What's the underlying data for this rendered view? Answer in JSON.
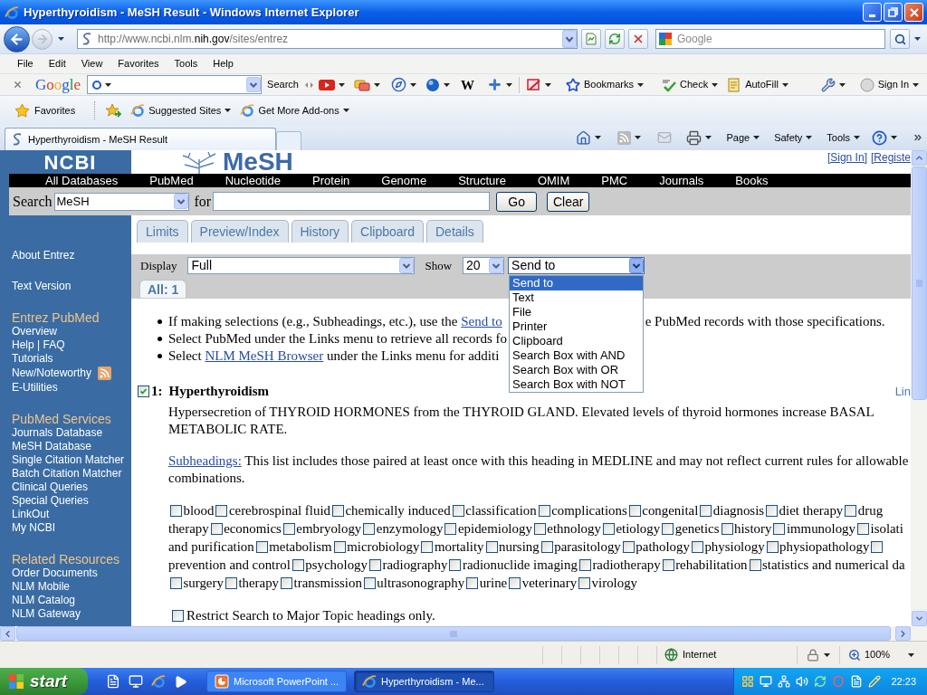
{
  "window": {
    "title": "Hyperthyroidism - MeSH Result - Windows Internet Explorer"
  },
  "address_bar": {
    "forward_button": {
      "disabled": true
    },
    "url_prefix": "http://www.ncbi.nlm.",
    "url_domain": "nih.gov",
    "url_path": "/sites/entrez",
    "search_placeholder": "Google"
  },
  "menu_bar": [
    "File",
    "Edit",
    "View",
    "Favorites",
    "Tools",
    "Help"
  ],
  "google_toolbar": {
    "logo": "Google",
    "search_button": "Search",
    "wiki_button": "W",
    "buttons": [
      "Bookmarks",
      "Check",
      "AutoFill",
      "Sign In"
    ]
  },
  "favorites_bar": {
    "favorites": "Favorites",
    "links": [
      "Suggested Sites",
      "Get More Add-ons"
    ]
  },
  "tabs": [
    {
      "label": "Hyperthyroidism - MeSH Result",
      "selected": true
    }
  ],
  "command_bar": {
    "read_mail": {
      "disabled": true
    },
    "menus": [
      "Page",
      "Safety",
      "Tools"
    ]
  },
  "page": {
    "header": {
      "ncbi_logo": "NCBI",
      "mesh_logo": "MeSH",
      "links": [
        "[Sign In]",
        "[Registe"
      ]
    },
    "databases": [
      "All Databases",
      "PubMed",
      "Nucleotide",
      "Protein",
      "Genome",
      "Structure",
      "OMIM",
      "PMC",
      "Journals",
      "Books"
    ],
    "search": {
      "label": "Search",
      "database": "MeSH",
      "for_label": "for",
      "buttons": [
        "Go",
        "Clear"
      ]
    },
    "sidebar": [
      {
        "items": [
          {
            "label": "About Entrez"
          }
        ]
      },
      {
        "items": [
          {
            "label": "Text Version"
          }
        ]
      },
      {
        "heading": "Entrez PubMed",
        "items": [
          {
            "label": "Overview"
          },
          {
            "label": "Help | FAQ"
          },
          {
            "label": "Tutorials"
          },
          {
            "label": "New/Noteworthy",
            "rss": true
          },
          {
            "label": "E-Utilities"
          }
        ]
      },
      {
        "heading": "PubMed Services",
        "items": [
          {
            "label": "Journals Database"
          },
          {
            "label": "MeSH Database"
          },
          {
            "label": "Single Citation Matcher"
          },
          {
            "label": "Batch Citation Matcher"
          },
          {
            "label": "Clinical Queries"
          },
          {
            "label": "Special Queries"
          },
          {
            "label": "LinkOut"
          },
          {
            "label": "My NCBI"
          }
        ]
      },
      {
        "heading": "Related Resources",
        "items": [
          {
            "label": "Order Documents"
          },
          {
            "label": "NLM Mobile"
          },
          {
            "label": "NLM Catalog"
          },
          {
            "label": "NLM Gateway"
          }
        ]
      }
    ],
    "tabs": [
      {
        "label": "Limits",
        "selected": false
      },
      {
        "label": "Preview/Index",
        "selected": false
      },
      {
        "label": "History",
        "selected": false
      },
      {
        "label": "Clipboard",
        "selected": false
      },
      {
        "label": "Details",
        "selected": false
      }
    ],
    "display": {
      "label": "Display",
      "value": "Full",
      "show_label": "Show",
      "show_value": "20",
      "send_to": {
        "value": "Send to",
        "expanded": true,
        "options": [
          {
            "label": "Send to",
            "selected": true
          },
          {
            "label": "Text",
            "selected": false
          },
          {
            "label": "File",
            "selected": false
          },
          {
            "label": "Printer",
            "selected": false
          },
          {
            "label": "Clipboard",
            "selected": false
          },
          {
            "label": "Search Box with AND",
            "selected": false
          },
          {
            "label": "Search Box with OR",
            "selected": false
          },
          {
            "label": "Search Box with NOT",
            "selected": false
          }
        ]
      }
    },
    "result_tabs": [
      {
        "label": "All: 1",
        "selected": true
      }
    ],
    "tips": [
      {
        "segments": [
          {
            "kind": "text",
            "text": "If making selections (e.g., Subheadings, etc.), use the "
          },
          {
            "kind": "link",
            "text": "Send to"
          },
          {
            "kind": "covered"
          },
          {
            "kind": "text",
            "text": "e PubMed records with those specifications."
          }
        ]
      },
      {
        "segments": [
          {
            "kind": "text",
            "text": "Select PubMed under the Links menu to retrieve all records fo"
          }
        ]
      },
      {
        "segments": [
          {
            "kind": "text",
            "text": "Select "
          },
          {
            "kind": "link",
            "text": "NLM MeSH Browser"
          },
          {
            "kind": "text",
            "text": " under the Links menu for additi"
          }
        ]
      }
    ],
    "record": {
      "checked": true,
      "number": "1:",
      "title": "Hyperthyroidism",
      "links": "Lin",
      "description": "Hypersecretion of THYROID HORMONES from the THYROID GLAND. Elevated levels of thyroid hormones increase BASAL METABOLIC RATE.",
      "subheadings_link": "Subheadings:",
      "subheadings_note": "This list includes those paired at least once with this heading in MEDLINE and may not reflect current rules for allowable combinations.",
      "subheading_lines": [
        [
          {
            "kind": "option",
            "label": "blood",
            "checked": false
          },
          {
            "kind": "option",
            "label": "cerebrospinal fluid",
            "checked": false
          },
          {
            "kind": "option",
            "label": "chemically induced",
            "checked": false
          },
          {
            "kind": "option",
            "label": "classification",
            "checked": false
          },
          {
            "kind": "option",
            "label": "complications",
            "checked": false
          },
          {
            "kind": "option",
            "label": "congenital",
            "checked": false
          },
          {
            "kind": "option",
            "label": "diagnosis",
            "checked": false
          },
          {
            "kind": "option",
            "label": "diet therapy",
            "checked": false
          },
          {
            "kind": "option",
            "label": "drug",
            "checked": false
          }
        ],
        [
          {
            "kind": "text",
            "label": "therapy"
          },
          {
            "kind": "option",
            "label": "economics",
            "checked": false
          },
          {
            "kind": "option",
            "label": "embryology",
            "checked": false
          },
          {
            "kind": "option",
            "label": "enzymology",
            "checked": false
          },
          {
            "kind": "option",
            "label": "epidemiology",
            "checked": false
          },
          {
            "kind": "option",
            "label": "ethnology",
            "checked": false
          },
          {
            "kind": "option",
            "label": "etiology",
            "checked": false
          },
          {
            "kind": "option",
            "label": "genetics",
            "checked": false
          },
          {
            "kind": "option",
            "label": "history",
            "checked": false
          },
          {
            "kind": "option",
            "label": "immunology",
            "checked": false
          },
          {
            "kind": "option",
            "label": "isolati",
            "checked": false
          }
        ],
        [
          {
            "kind": "text",
            "label": "and purification"
          },
          {
            "kind": "option",
            "label": "metabolism",
            "checked": false
          },
          {
            "kind": "option",
            "label": "microbiology",
            "checked": false
          },
          {
            "kind": "option",
            "label": "mortality",
            "checked": false
          },
          {
            "kind": "option",
            "label": "nursing",
            "checked": false
          },
          {
            "kind": "option",
            "label": "parasitology",
            "checked": false
          },
          {
            "kind": "option",
            "label": "pathology",
            "checked": false
          },
          {
            "kind": "option",
            "label": "physiology",
            "checked": false
          },
          {
            "kind": "option",
            "label": "physiopathology",
            "checked": false
          },
          {
            "kind": "box",
            "checked": false
          }
        ],
        [
          {
            "kind": "text",
            "label": "prevention and control"
          },
          {
            "kind": "option",
            "label": "psychology",
            "checked": false
          },
          {
            "kind": "option",
            "label": "radiography",
            "checked": false
          },
          {
            "kind": "option",
            "label": "radionuclide imaging",
            "checked": false
          },
          {
            "kind": "option",
            "label": "radiotherapy",
            "checked": false
          },
          {
            "kind": "option",
            "label": "rehabilitation",
            "checked": false
          },
          {
            "kind": "option",
            "label": "statistics and numerical da",
            "checked": false
          }
        ],
        [
          {
            "kind": "option",
            "label": "surgery",
            "checked": false
          },
          {
            "kind": "option",
            "label": "therapy",
            "checked": false
          },
          {
            "kind": "option",
            "label": "transmission",
            "checked": false
          },
          {
            "kind": "option",
            "label": "ultrasonography",
            "checked": false
          },
          {
            "kind": "option",
            "label": "urine",
            "checked": false
          },
          {
            "kind": "option",
            "label": "veterinary",
            "checked": false
          },
          {
            "kind": "option",
            "label": "virology",
            "checked": false
          }
        ]
      ],
      "restrict": {
        "checked": false,
        "label": "Restrict Search to Major Topic headings only."
      }
    }
  },
  "status_bar": {
    "zone": "Internet",
    "zoom": "100%"
  },
  "taskbar": {
    "start": "start",
    "buttons": [
      {
        "label": "Microsoft PowerPoint ...",
        "selected": false
      },
      {
        "label": "Hyperthyroidism - Me...",
        "selected": true
      }
    ],
    "clock": "22:23"
  }
}
